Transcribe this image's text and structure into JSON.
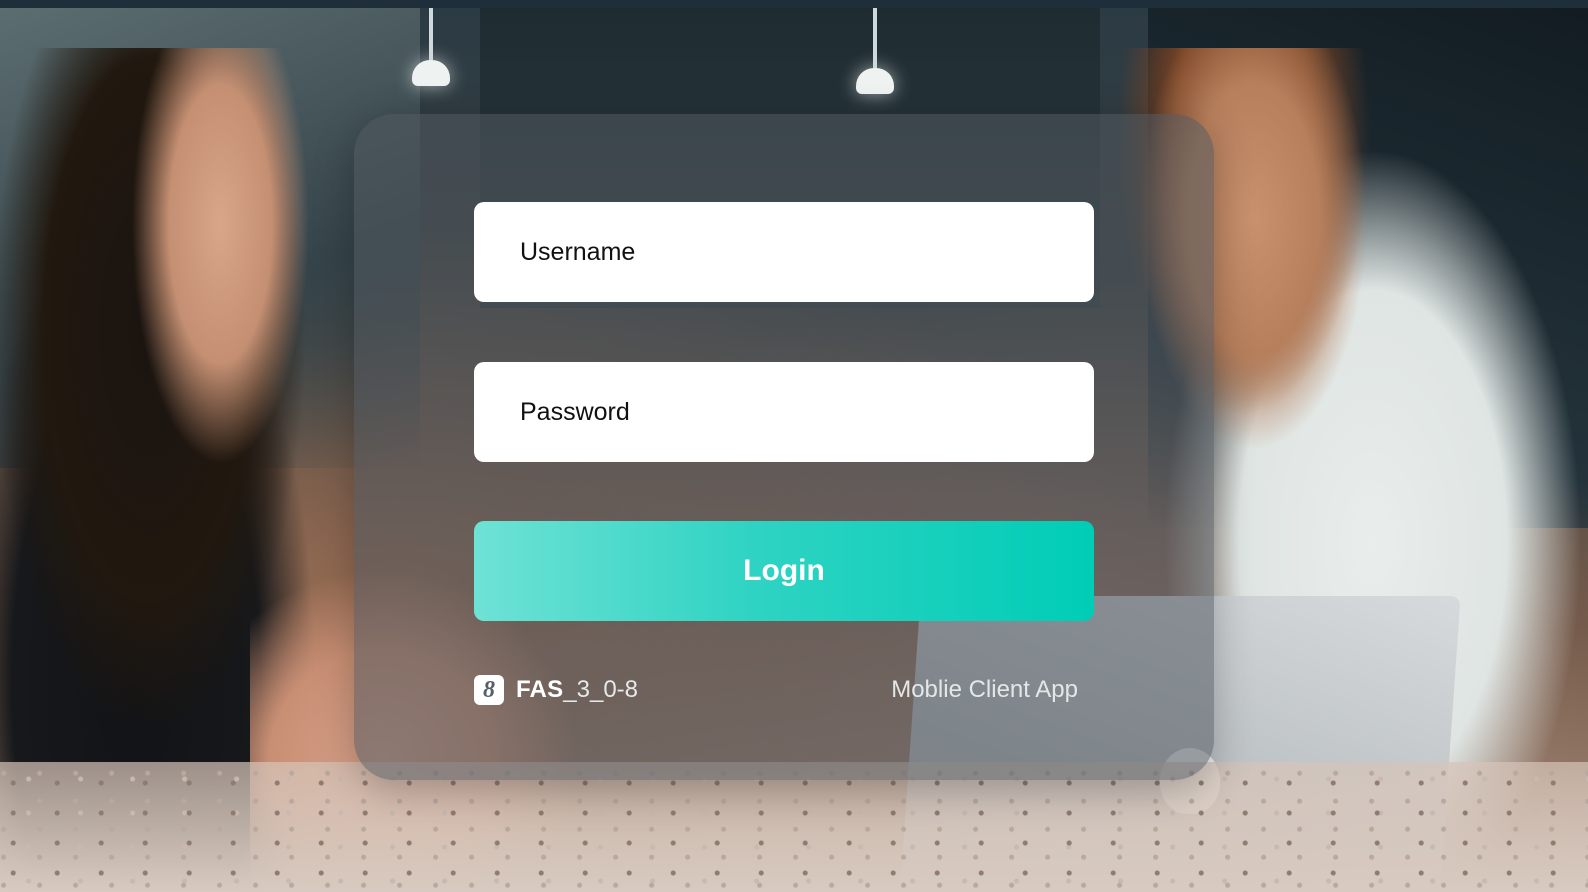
{
  "login": {
    "username_placeholder": "Username",
    "password_placeholder": "Password",
    "login_label": "Login"
  },
  "footer": {
    "badge_glyph": "8",
    "brand": "FAS",
    "version": "_3_0-8",
    "app_name": "Moblie Client App"
  },
  "colors": {
    "button_start": "#6ee2d5",
    "button_end": "#00cdb6",
    "card_overlay": "#50585e"
  },
  "icons": {
    "app_badge": "app-logo-icon"
  }
}
